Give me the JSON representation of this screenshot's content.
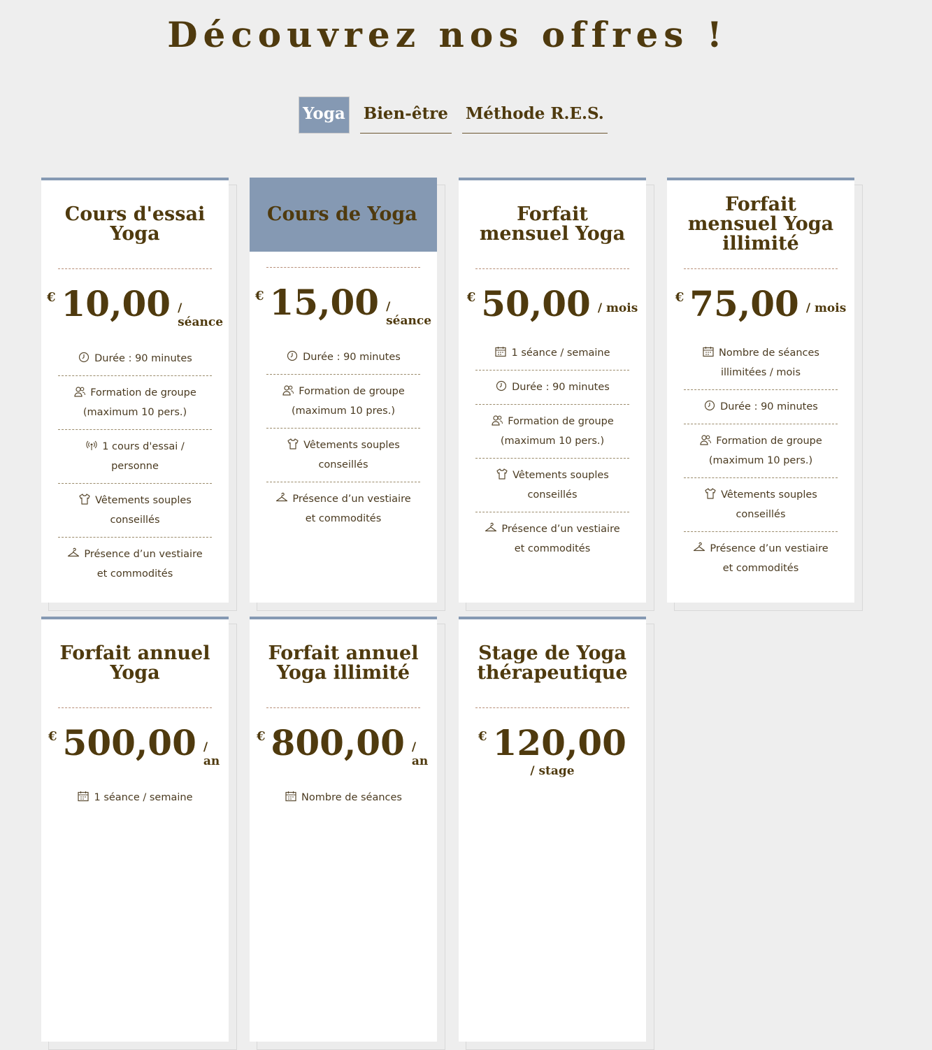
{
  "page": {
    "title": "Découvrez nos offres !"
  },
  "tabs": [
    {
      "label": "Yoga",
      "active": true
    },
    {
      "label": "Bien-être",
      "active": false
    },
    {
      "label": "Méthode R.E.S.",
      "active": false
    }
  ],
  "colors": {
    "accent": "#8599b3",
    "text": "#4f3a0e",
    "background": "#eeeeee"
  },
  "cards": [
    {
      "title": "Cours d'essai Yoga",
      "currency": "€",
      "amount": "10,00",
      "period": "/ séance",
      "features": [
        {
          "icon": "clock-icon",
          "text": "Durée : 90 minutes"
        },
        {
          "icon": "group-icon",
          "text": "Formation de groupe (maximum 10 pers.)"
        },
        {
          "icon": "broadcast-icon",
          "text": "1 cours d'essai / personne"
        },
        {
          "icon": "shirt-icon",
          "text": "Vêtements souples conseillés"
        },
        {
          "icon": "hanger-icon",
          "text": "Présence d’un vestiaire et commodités"
        }
      ]
    },
    {
      "title": "Cours de Yoga",
      "featured": true,
      "currency": "€",
      "amount": "15,00",
      "period": "/ séance",
      "features": [
        {
          "icon": "clock-icon",
          "text": "Durée : 90 minutes"
        },
        {
          "icon": "group-icon",
          "text": "Formation de groupe (maximum 10 pres.)"
        },
        {
          "icon": "shirt-icon",
          "text": "Vêtements souples conseillés"
        },
        {
          "icon": "hanger-icon",
          "text": "Présence d’un vestiaire et commodités"
        }
      ]
    },
    {
      "title": "Forfait mensuel Yoga",
      "currency": "€",
      "amount": "50,00",
      "period": "/ mois",
      "features": [
        {
          "icon": "calendar-icon",
          "text": "1 séance / semaine"
        },
        {
          "icon": "clock-icon",
          "text": "Durée : 90 minutes"
        },
        {
          "icon": "group-icon",
          "text": "Formation de groupe (maximum 10 pers.)"
        },
        {
          "icon": "shirt-icon",
          "text": "Vêtements souples conseillés"
        },
        {
          "icon": "hanger-icon",
          "text": "Présence d’un vestiaire et commodités"
        }
      ]
    },
    {
      "title": "Forfait mensuel Yoga illimité",
      "currency": "€",
      "amount": "75,00",
      "period": "/ mois",
      "features": [
        {
          "icon": "calendar-icon",
          "text": "Nombre de séances illimitées / mois"
        },
        {
          "icon": "clock-icon",
          "text": "Durée : 90 minutes"
        },
        {
          "icon": "group-icon",
          "text": "Formation de groupe (maximum 10 pers.)"
        },
        {
          "icon": "shirt-icon",
          "text": "Vêtements souples conseillés"
        },
        {
          "icon": "hanger-icon",
          "text": "Présence d’un vestiaire et commodités"
        }
      ]
    },
    {
      "title": "Forfait annuel Yoga",
      "currency": "€",
      "amount": "500,00",
      "period": "/ an",
      "features": [
        {
          "icon": "calendar-icon",
          "text": "1 séance / semaine"
        }
      ]
    },
    {
      "title": "Forfait annuel Yoga illimité",
      "currency": "€",
      "amount": "800,00",
      "period": "/ an",
      "features": [
        {
          "icon": "calendar-icon",
          "text": "Nombre de séances"
        }
      ]
    },
    {
      "title": "Stage de Yoga thérapeutique",
      "currency": "€",
      "amount": "120,00",
      "period": "/ stage",
      "features": []
    }
  ]
}
